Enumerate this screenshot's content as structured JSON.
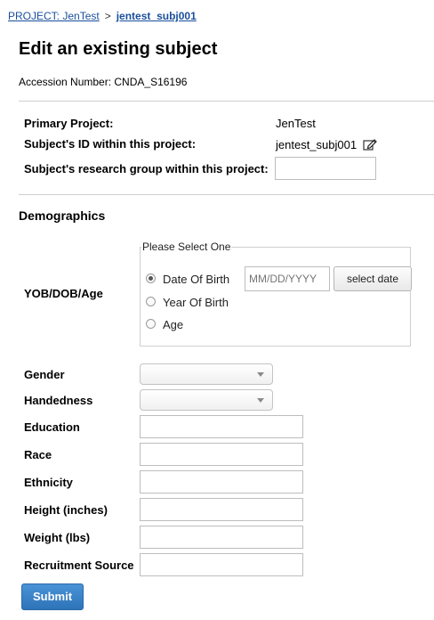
{
  "breadcrumb": {
    "project_link": "PROJECT: JenTest",
    "separator": ">",
    "current": "jentest_subj001"
  },
  "page_title": "Edit an existing subject",
  "accession": {
    "label": "Accession Number:",
    "value": "CNDA_S16196"
  },
  "primary_project": {
    "label": "Primary Project:",
    "value": "JenTest"
  },
  "subject_id": {
    "label": "Subject's ID within this project:",
    "value": "jentest_subj001"
  },
  "research_group": {
    "label": "Subject's research group within this project:",
    "value": ""
  },
  "demographics": {
    "heading": "Demographics",
    "yob_label": "YOB/DOB/Age",
    "select_legend": "Please Select One",
    "options": [
      "Date Of Birth",
      "Year Of Birth",
      "Age"
    ],
    "selected_option": "Date Of Birth",
    "date_placeholder": "MM/DD/YYYY",
    "select_date_button": "select date",
    "fields": {
      "gender": "Gender",
      "handedness": "Handedness",
      "education": "Education",
      "race": "Race",
      "ethnicity": "Ethnicity",
      "height": "Height (inches)",
      "weight": "Weight (lbs)",
      "recruitment": "Recruitment Source"
    }
  },
  "submit_label": "Submit"
}
